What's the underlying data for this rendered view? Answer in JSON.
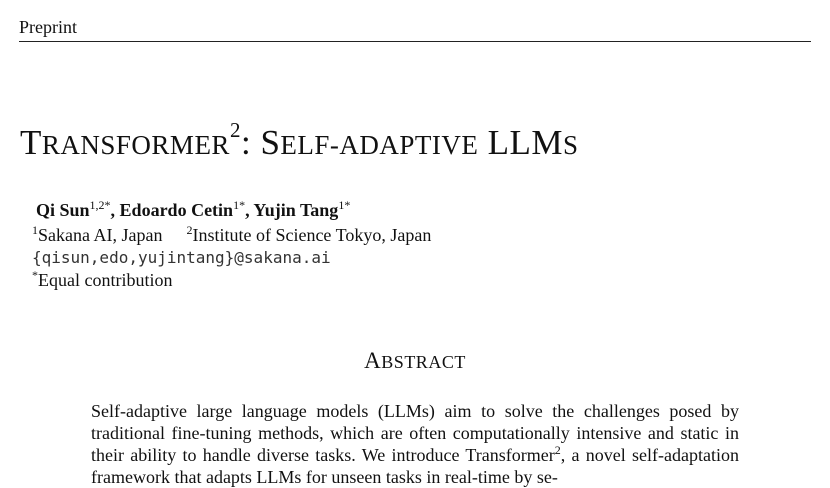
{
  "header": {
    "label": "Preprint"
  },
  "title": {
    "first_cap": "T",
    "first_rest": "RANSFORMER",
    "superscript": "2",
    "colon": ":",
    "second_cap": "S",
    "second_rest": "ELF-ADAPTIVE",
    "third": "LLM",
    "third_rest": "S"
  },
  "authors": [
    {
      "name": "Qi Sun",
      "affil": "1,2*",
      "sep": ", "
    },
    {
      "name": "Edoardo Cetin",
      "affil": "1*",
      "sep": ", "
    },
    {
      "name": "Yujin Tang",
      "affil": "1*",
      "sep": ""
    }
  ],
  "affiliations": [
    {
      "mark": "1",
      "text": "Sakana AI, Japan"
    },
    {
      "mark": "2",
      "text": "Institute of Science Tokyo, Japan"
    }
  ],
  "emails": "{qisun,edo,yujintang}@sakana.ai",
  "note": {
    "mark": "*",
    "text": "Equal contribution"
  },
  "abstract": {
    "title_cap": "A",
    "title_rest": "BSTRACT",
    "text_part1": "Self-adaptive large language models (LLMs) aim to solve the challenges posed by traditional fine-tuning methods, which are often computationally intensive and static in their ability to handle diverse tasks. We introduce Transformer",
    "text_sup": "2",
    "text_part2": ", a novel self-adaptation framework that adapts LLMs for unseen tasks in real-time by se-"
  }
}
